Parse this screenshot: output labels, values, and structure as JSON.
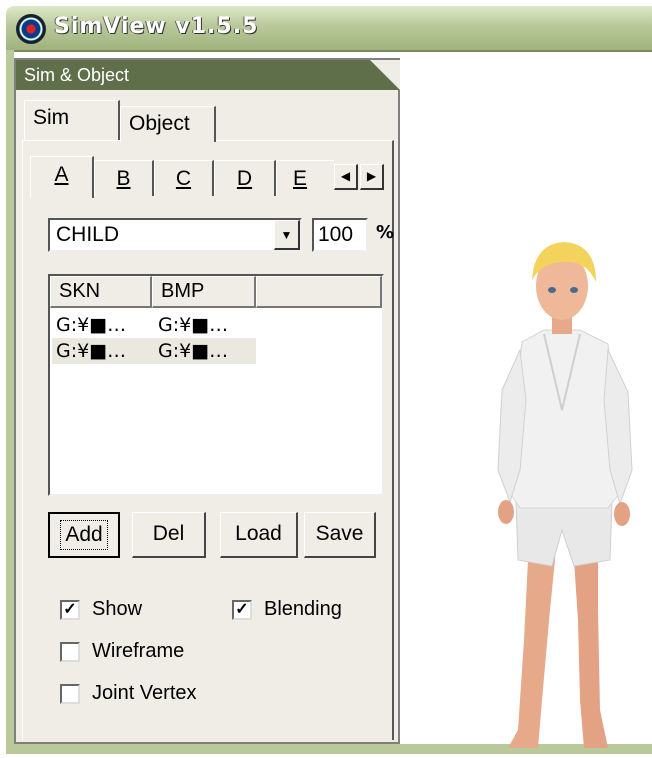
{
  "window": {
    "title": "SimView v1.5.5",
    "icon": "app-logo-icon"
  },
  "panel": {
    "title": "Sim & Object"
  },
  "tabs": [
    {
      "label": "Sim"
    },
    {
      "label": "Object"
    }
  ],
  "subtabs": [
    {
      "label": "A"
    },
    {
      "label": "B"
    },
    {
      "label": "C"
    },
    {
      "label": "D"
    },
    {
      "label": "E"
    }
  ],
  "age_select": {
    "value": "CHILD"
  },
  "scale": {
    "value": "100",
    "unit": "%"
  },
  "mesh_list": {
    "columns": [
      "SKN",
      "BMP"
    ],
    "rows": [
      [
        "G:¥■…",
        "G:¥■…"
      ],
      [
        "G:¥■…",
        "G:¥■…"
      ]
    ]
  },
  "buttons": {
    "add": "Add",
    "del": "Del",
    "load": "Load",
    "save": "Save"
  },
  "options": {
    "show": {
      "label": "Show",
      "checked": true
    },
    "blending": {
      "label": "Blending",
      "checked": true
    },
    "wireframe": {
      "label": "Wireframe",
      "checked": false
    },
    "joint_vertex": {
      "label": "Joint Vertex",
      "checked": false
    }
  }
}
